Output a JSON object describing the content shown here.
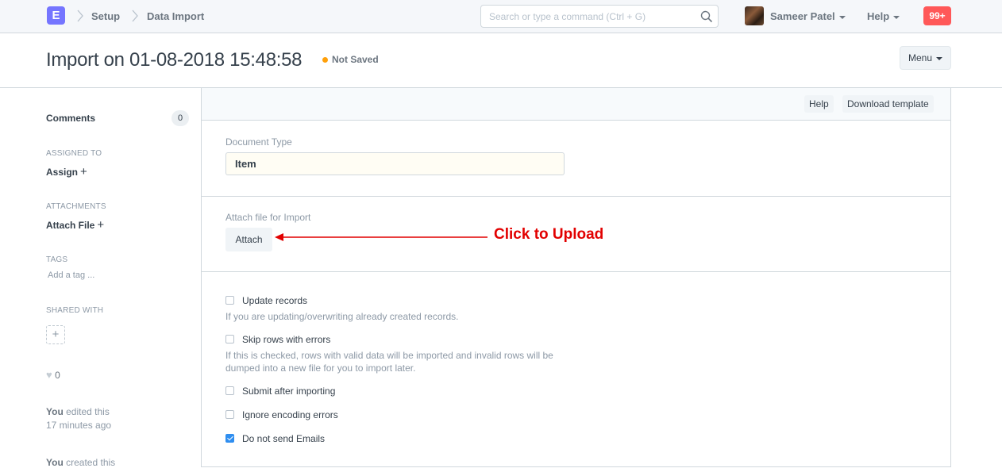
{
  "navbar": {
    "logo_letter": "E",
    "breadcrumbs": [
      "Setup",
      "Data Import"
    ],
    "search_placeholder": "Search or type a command (Ctrl + G)",
    "user_name": "Sameer Patel",
    "help_label": "Help",
    "notification_count": "99+"
  },
  "page_head": {
    "title": "Import on 01-08-2018 15:48:58",
    "status": "Not Saved",
    "menu_label": "Menu"
  },
  "sidebar": {
    "comments_label": "Comments",
    "comments_count": "0",
    "assigned_to_label": "ASSIGNED TO",
    "assign_label": "Assign",
    "attachments_label": "ATTACHMENTS",
    "attach_file_label": "Attach File",
    "tags_label": "TAGS",
    "add_tag_label": "Add a tag ...",
    "shared_with_label": "SHARED WITH",
    "likes_count": "0",
    "timeline": [
      {
        "who": "You",
        "action": "edited this",
        "when": "17 minutes ago"
      },
      {
        "who": "You",
        "action": "created this",
        "when": ""
      }
    ]
  },
  "toolbar": {
    "help_label": "Help",
    "download_template_label": "Download template"
  },
  "form": {
    "document_type_label": "Document Type",
    "document_type_value": "Item",
    "attach_file_label": "Attach file for Import",
    "attach_button_label": "Attach",
    "annotation": "Click to Upload",
    "options": [
      {
        "label": "Update records",
        "checked": false,
        "help": "If you are updating/overwriting already created records."
      },
      {
        "label": "Skip rows with errors",
        "checked": false,
        "help": "If this is checked, rows with valid data will be imported and invalid rows will be dumped into a new file for you to import later."
      },
      {
        "label": "Submit after importing",
        "checked": false,
        "help": ""
      },
      {
        "label": "Ignore encoding errors",
        "checked": false,
        "help": ""
      },
      {
        "label": "Do not send Emails",
        "checked": true,
        "help": ""
      }
    ]
  },
  "colors": {
    "brand": "#7575ff",
    "notification": "#ff5858",
    "status_dot": "#ffa00a",
    "annotation": "#e20000",
    "checkbox_checked": "#2f8ef0"
  }
}
